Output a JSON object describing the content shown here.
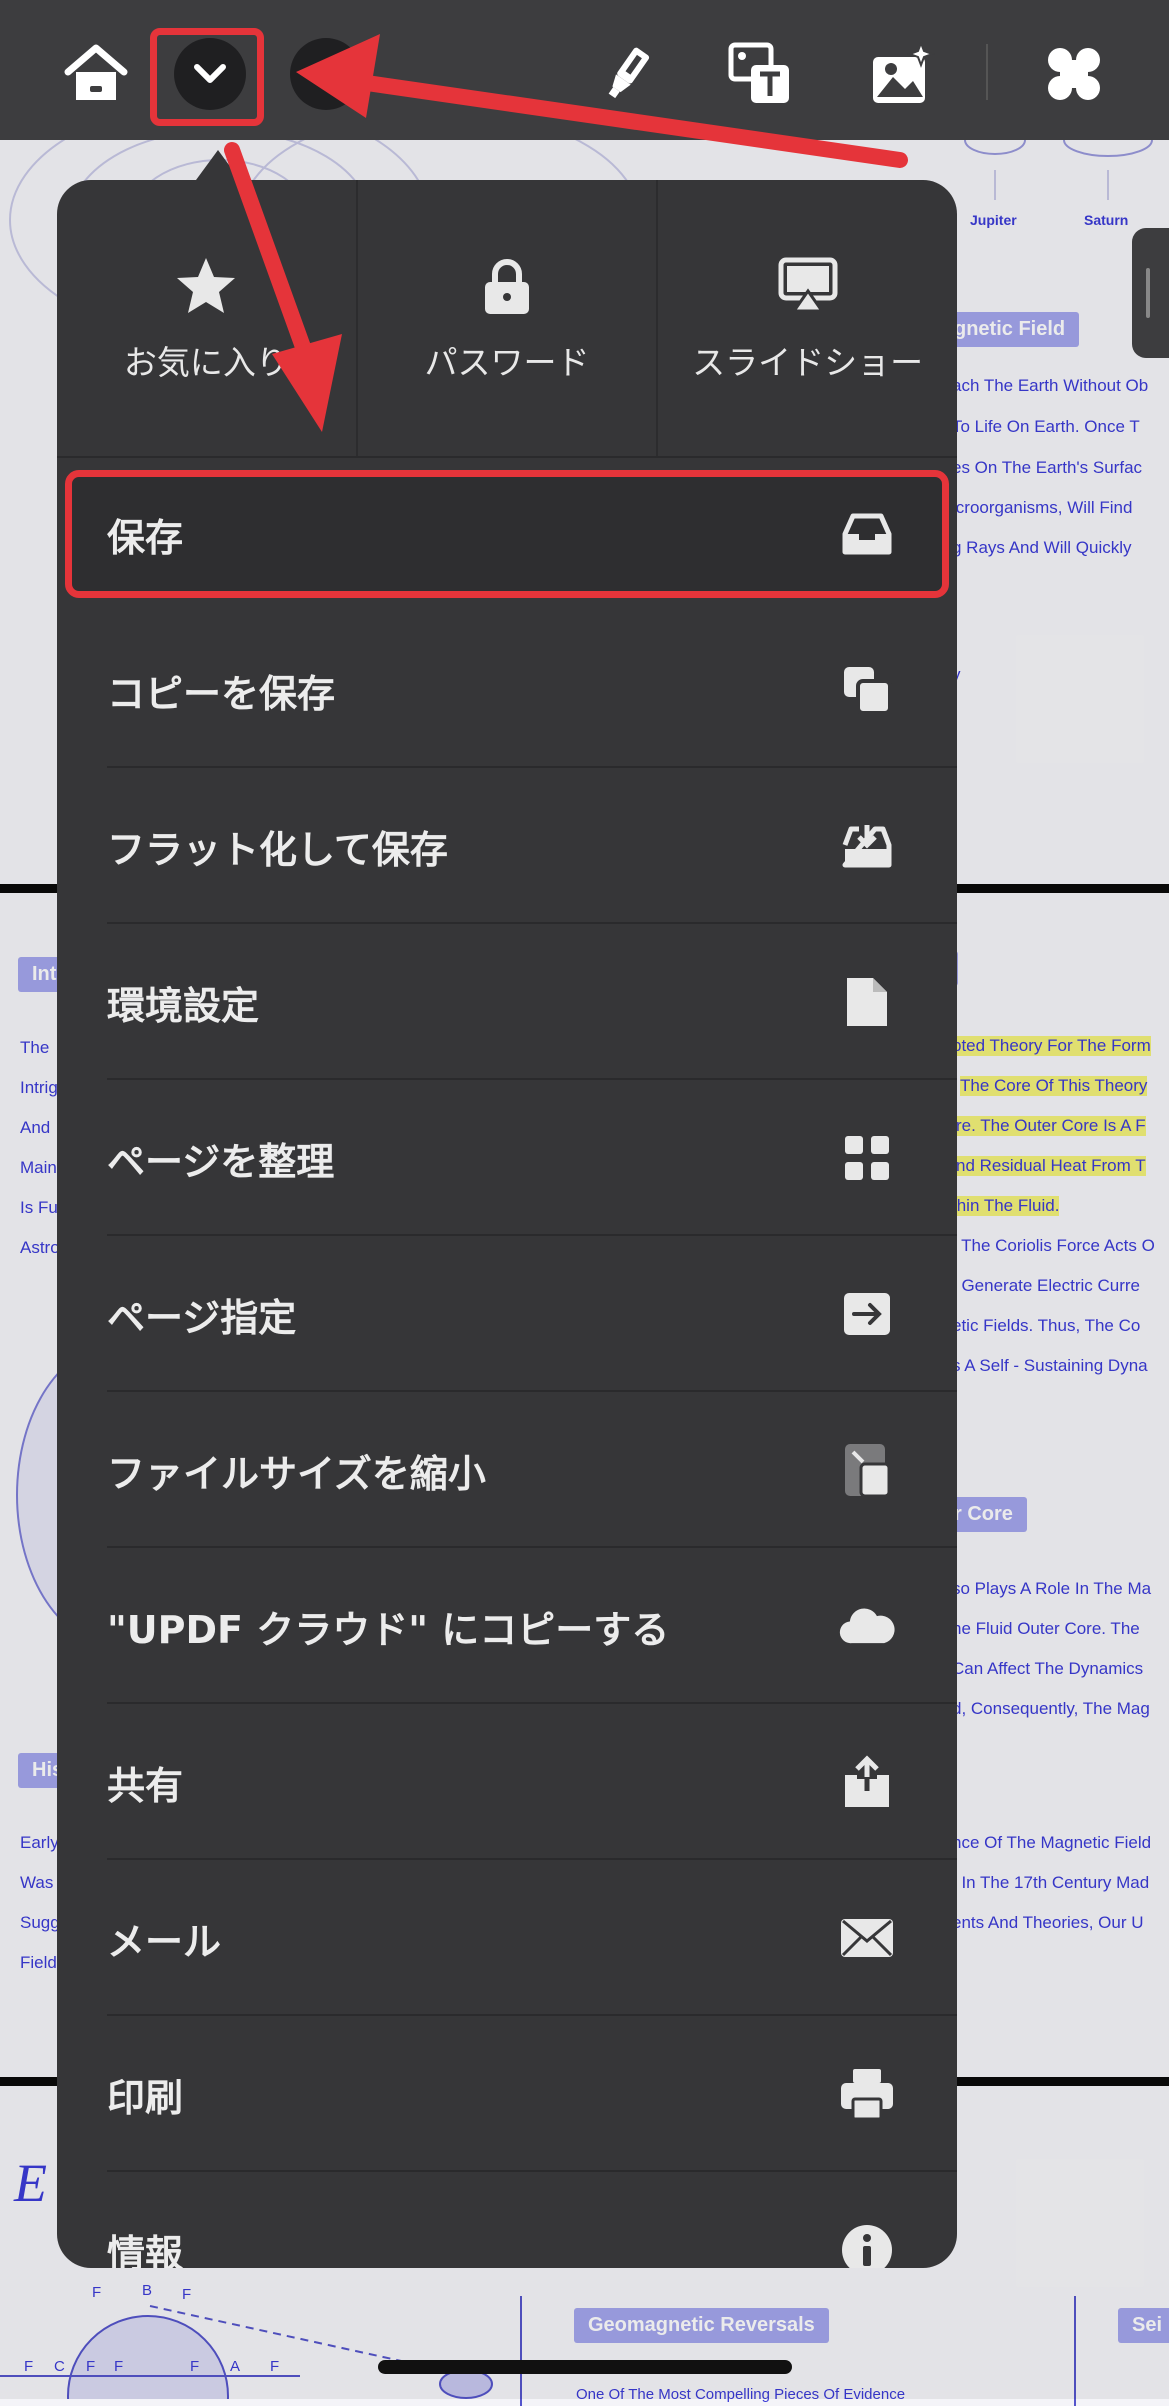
{
  "toolbar": {
    "home": "home-icon",
    "collapse": "chevron-down-icon",
    "back": "back-arrow-icon",
    "pen": "highlighter-icon",
    "image_text": "image-text-icon",
    "image_ai": "image-sparkle-icon",
    "apps": "apps-icon"
  },
  "quick_actions": [
    {
      "label": "お気に入り",
      "icon": "star-icon"
    },
    {
      "label": "パスワード",
      "icon": "lock-icon"
    },
    {
      "label": "スライドショー",
      "icon": "airplay-icon"
    }
  ],
  "menu_items": [
    {
      "label": "保存",
      "icon": "tray-icon"
    },
    {
      "label": "コピーを保存",
      "icon": "copy-icon"
    },
    {
      "label": "フラット化して保存",
      "icon": "download-tray-icon"
    },
    {
      "label": "環境設定",
      "icon": "document-icon"
    },
    {
      "label": "ページを整理",
      "icon": "grid-icon"
    },
    {
      "label": "ページ指定",
      "icon": "arrow-right-box-icon"
    },
    {
      "label": "ファイルサイズを縮小",
      "icon": "compress-icon"
    },
    {
      "label": " \"UPDF クラウド\" にコピーする",
      "icon": "cloud-icon"
    },
    {
      "label": "共有",
      "icon": "share-icon"
    },
    {
      "label": "メール",
      "icon": "mail-icon"
    },
    {
      "label": "印刷",
      "icon": "printer-icon"
    },
    {
      "label": "情報",
      "icon": "info-icon"
    }
  ],
  "colors": {
    "annotation": "#e5343a",
    "menu_bg": "#363638",
    "toolbar_bg": "#3d3d3f"
  },
  "background_doc": {
    "top_labels": [
      "Jupiter",
      "Saturn"
    ],
    "headings": [
      "gnetic Field",
      "r Core",
      "Geomagnetic Reversals",
      "Int",
      "His",
      "Sei"
    ],
    "page1_lines": [
      "ach The Earth Without Ob",
      "To Life On Earth. Once T",
      "es On The Earth's Surfac",
      "icroorganisms, Will Find",
      "g Rays And Will Quickly",
      "y"
    ],
    "page2_lines": [
      "pted Theory For The Form",
      "The Core Of This Theory",
      "re. The Outer Core Is A F",
      "nd Residual Heat From T",
      "thin The Fluid.",
      "t The Coriolis Force Acts O",
      "t Generate Electric Curre",
      "etic Fields. Thus, The Co",
      "s A Self - Sustaining Dyna"
    ],
    "page2_left": [
      "The",
      "Intrig",
      "And",
      "Main",
      "Is Fu",
      "Astro"
    ],
    "page2_lines_b": [
      "so Plays A Role In The Ma",
      "he Fluid Outer Core. The",
      "Can Affect The Dynamics",
      "d, Consequently, The Mag"
    ],
    "page2_left_b": [
      "Early",
      "Was",
      "Sugg",
      "Field"
    ],
    "page2_lines_c": [
      "nce Of The Magnetic Field",
      "t In The 17th Century Mad",
      "ents And Theories, Our U"
    ],
    "page3_script": "E",
    "page3_sub": "One Of The Most Compelling Pieces Of Evidence",
    "diagram_labels": [
      "F",
      "B",
      "F",
      "F",
      "C",
      "F",
      "F",
      "F",
      "A",
      "F"
    ]
  }
}
